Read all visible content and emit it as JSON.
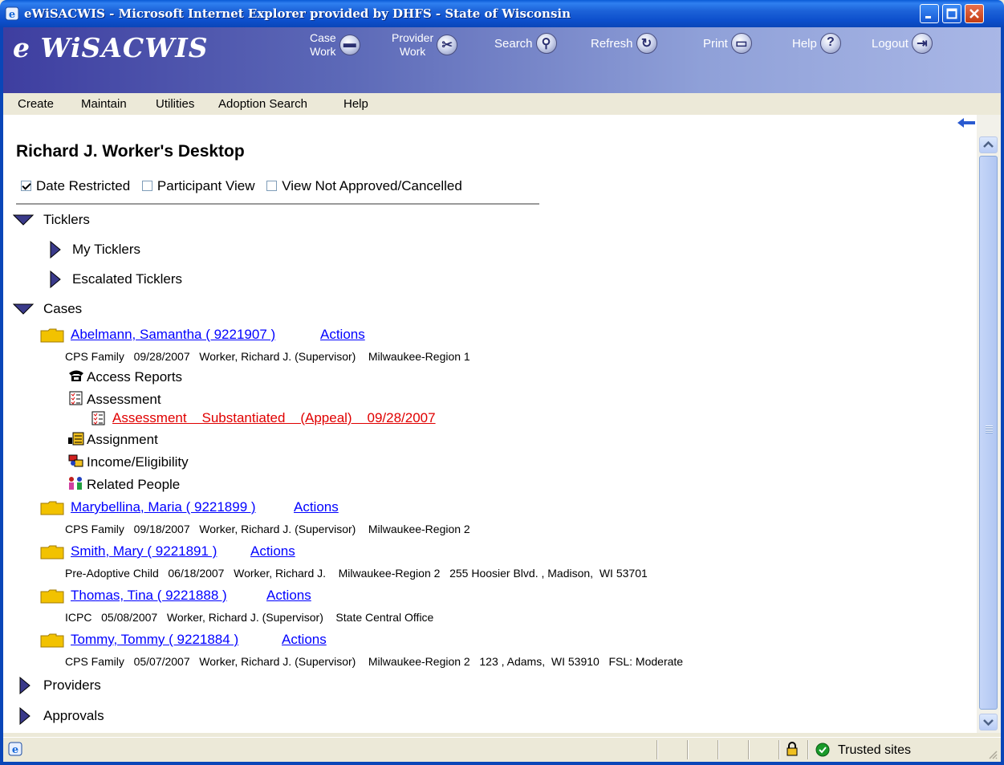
{
  "window": {
    "title": "eWiSACWIS - Microsoft Internet Explorer provided by DHFS - State of Wisconsin"
  },
  "header": {
    "brand": "e WiSACWIS",
    "nav": {
      "case_work_line1": "Case",
      "case_work_line2": "Work",
      "provider_work_line1": "Provider",
      "provider_work_line2": "Work",
      "search": "Search",
      "refresh": "Refresh",
      "print": "Print",
      "help": "Help",
      "logout": "Logout"
    }
  },
  "menu": {
    "create": "Create",
    "maintain": "Maintain",
    "utilities": "Utilities",
    "adoption_search": "Adoption Search",
    "help": "Help"
  },
  "page": {
    "title": "Richard J. Worker's Desktop",
    "filters": {
      "date_restricted": {
        "label": "Date Restricted",
        "checked": true
      },
      "participant_view": {
        "label": "Participant View",
        "checked": false
      },
      "view_not_approved": {
        "label": "View Not Approved/Cancelled",
        "checked": false
      }
    }
  },
  "tree": {
    "ticklers": {
      "label": "Ticklers",
      "my_ticklers": "My Ticklers",
      "escalated_ticklers": "Escalated Ticklers"
    },
    "cases_label": "Cases",
    "cases": [
      {
        "name": "Abelmann, Samantha ( 9221907 )",
        "actions": "Actions",
        "detail": "CPS Family   09/28/2007   Worker, Richard J. (Supervisor)    Milwaukee-Region 1",
        "children": {
          "access_reports": "Access Reports",
          "assessment": "Assessment",
          "assessment_link": "Assessment    Substantiated    (Appeal)    09/28/2007",
          "assignment": "Assignment",
          "income_eligibility": "Income/Eligibility",
          "related_people": "Related People"
        }
      },
      {
        "name": "Marybellina, Maria ( 9221899 )",
        "actions": "Actions",
        "detail": "CPS Family   09/18/2007   Worker, Richard J. (Supervisor)    Milwaukee-Region 2"
      },
      {
        "name": "Smith, Mary ( 9221891 )",
        "actions": "Actions",
        "detail": "Pre-Adoptive Child   06/18/2007   Worker, Richard J.    Milwaukee-Region 2   255 Hoosier Blvd. , Madison,  WI 53701"
      },
      {
        "name": "Thomas, Tina ( 9221888 )",
        "actions": "Actions",
        "detail": "ICPC   05/08/2007   Worker, Richard J. (Supervisor)    State Central Office"
      },
      {
        "name": "Tommy, Tommy ( 9221884 )",
        "actions": "Actions",
        "detail": "CPS Family   05/07/2007   Worker, Richard J. (Supervisor)    Milwaukee-Region 2   123 , Adams,  WI 53910   FSL: Moderate"
      }
    ],
    "providers": "Providers",
    "approvals": "Approvals"
  },
  "statusbar": {
    "zone": "Trusted sites"
  },
  "colors": {
    "link": "#0000ff",
    "alert_link": "#e00000",
    "titlebar": "#0a46b8",
    "brand_bar_start": "#3e3ea0",
    "brand_bar_end": "#a9b7e6"
  }
}
